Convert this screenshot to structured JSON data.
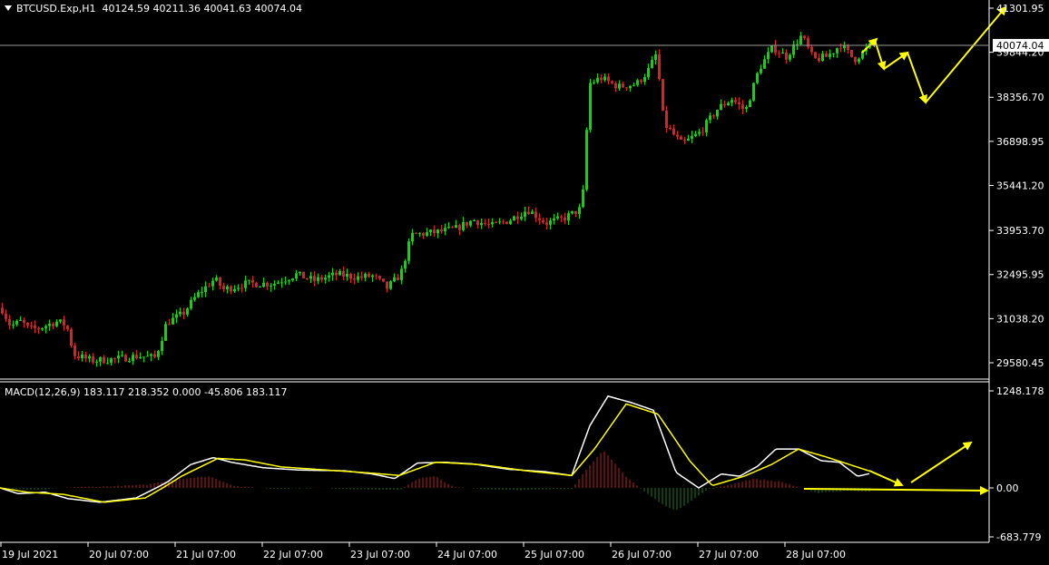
{
  "header": {
    "symbol": "BTCUSD.Exp,H1",
    "ohlc": "40124.59 40211.36 40041.63 40074.04"
  },
  "macd_header": "MACD(12,26,9) 183.117 218.352 0.000 -45.806 183.117",
  "colors": {
    "background": "#000000",
    "bull_candle": "#00e000",
    "bear_candle": "#e02020",
    "annotation": "#ffff00",
    "macd_line": "#ffffff",
    "signal_line": "#ffff00",
    "hist_pos": "#b22222",
    "hist_neg": "#1f7a1f",
    "grid": "#ffffff"
  },
  "price_axis": {
    "labels": [
      "41301.95",
      "39844.20",
      "38356.70",
      "36898.95",
      "35441.20",
      "33953.70",
      "32495.95",
      "31038.20",
      "29580.45"
    ],
    "current_price": "40074.04"
  },
  "macd_axis": {
    "labels": [
      "1248.178",
      "0.00",
      "-683.779"
    ]
  },
  "time_axis": {
    "labels": [
      "19 Jul 2021",
      "20 Jul 07:00",
      "21 Jul 07:00",
      "22 Jul 07:00",
      "23 Jul 07:00",
      "24 Jul 07:00",
      "25 Jul 07:00",
      "26 Jul 07:00",
      "27 Jul 07:00",
      "28 Jul 07:00"
    ]
  },
  "chart_data": {
    "type": "candlestick",
    "symbol": "BTCUSD.Exp",
    "timeframe": "H1",
    "y_range": [
      29200,
      41500
    ],
    "close_path": [
      {
        "t": 0,
        "v": 31400
      },
      {
        "t": 10,
        "v": 30800
      },
      {
        "t": 22,
        "v": 30950
      },
      {
        "t": 30,
        "v": 30700
      },
      {
        "t": 40,
        "v": 30700
      },
      {
        "t": 52,
        "v": 30850
      },
      {
        "t": 62,
        "v": 30950
      },
      {
        "t": 72,
        "v": 30800
      },
      {
        "t": 80,
        "v": 29850
      },
      {
        "t": 100,
        "v": 29650
      },
      {
        "t": 125,
        "v": 29700
      },
      {
        "t": 150,
        "v": 29800
      },
      {
        "t": 170,
        "v": 29750
      },
      {
        "t": 182,
        "v": 30900
      },
      {
        "t": 200,
        "v": 31200
      },
      {
        "t": 215,
        "v": 31800
      },
      {
        "t": 235,
        "v": 32350
      },
      {
        "t": 245,
        "v": 32000
      },
      {
        "t": 270,
        "v": 32200
      },
      {
        "t": 300,
        "v": 32200
      },
      {
        "t": 325,
        "v": 32500
      },
      {
        "t": 345,
        "v": 32300
      },
      {
        "t": 370,
        "v": 32500
      },
      {
        "t": 395,
        "v": 32400
      },
      {
        "t": 410,
        "v": 32450
      },
      {
        "t": 425,
        "v": 32050
      },
      {
        "t": 440,
        "v": 32500
      },
      {
        "t": 452,
        "v": 33800
      },
      {
        "t": 480,
        "v": 33900
      },
      {
        "t": 500,
        "v": 34000
      },
      {
        "t": 520,
        "v": 34300
      },
      {
        "t": 540,
        "v": 34100
      },
      {
        "t": 560,
        "v": 34300
      },
      {
        "t": 580,
        "v": 34650
      },
      {
        "t": 600,
        "v": 34200
      },
      {
        "t": 620,
        "v": 34350
      },
      {
        "t": 640,
        "v": 34700
      },
      {
        "t": 648,
        "v": 38800
      },
      {
        "t": 660,
        "v": 39000
      },
      {
        "t": 680,
        "v": 38700
      },
      {
        "t": 700,
        "v": 38800
      },
      {
        "t": 712,
        "v": 39200
      },
      {
        "t": 722,
        "v": 39800
      },
      {
        "t": 730,
        "v": 37500
      },
      {
        "t": 750,
        "v": 36800
      },
      {
        "t": 770,
        "v": 37200
      },
      {
        "t": 790,
        "v": 38000
      },
      {
        "t": 805,
        "v": 38300
      },
      {
        "t": 820,
        "v": 37900
      },
      {
        "t": 835,
        "v": 39300
      },
      {
        "t": 850,
        "v": 40000
      },
      {
        "t": 865,
        "v": 39700
      },
      {
        "t": 882,
        "v": 40400
      },
      {
        "t": 895,
        "v": 39600
      },
      {
        "t": 910,
        "v": 39700
      },
      {
        "t": 925,
        "v": 40100
      },
      {
        "t": 940,
        "v": 39600
      },
      {
        "t": 958,
        "v": 40074
      }
    ],
    "macd_line": [
      {
        "t": 0,
        "v": 0
      },
      {
        "t": 20,
        "v": -80
      },
      {
        "t": 50,
        "v": -60
      },
      {
        "t": 75,
        "v": -150
      },
      {
        "t": 110,
        "v": -200
      },
      {
        "t": 150,
        "v": -140
      },
      {
        "t": 185,
        "v": 80
      },
      {
        "t": 210,
        "v": 300
      },
      {
        "t": 235,
        "v": 390
      },
      {
        "t": 255,
        "v": 330
      },
      {
        "t": 290,
        "v": 260
      },
      {
        "t": 330,
        "v": 230
      },
      {
        "t": 380,
        "v": 220
      },
      {
        "t": 410,
        "v": 180
      },
      {
        "t": 435,
        "v": 120
      },
      {
        "t": 460,
        "v": 320
      },
      {
        "t": 490,
        "v": 330
      },
      {
        "t": 520,
        "v": 310
      },
      {
        "t": 560,
        "v": 240
      },
      {
        "t": 600,
        "v": 210
      },
      {
        "t": 630,
        "v": 160
      },
      {
        "t": 650,
        "v": 800
      },
      {
        "t": 670,
        "v": 1180
      },
      {
        "t": 695,
        "v": 1100
      },
      {
        "t": 720,
        "v": 1000
      },
      {
        "t": 745,
        "v": 200
      },
      {
        "t": 770,
        "v": 0
      },
      {
        "t": 795,
        "v": 180
      },
      {
        "t": 815,
        "v": 150
      },
      {
        "t": 835,
        "v": 280
      },
      {
        "t": 855,
        "v": 500
      },
      {
        "t": 880,
        "v": 500
      },
      {
        "t": 905,
        "v": 350
      },
      {
        "t": 925,
        "v": 330
      },
      {
        "t": 945,
        "v": 150
      },
      {
        "t": 958,
        "v": 183
      }
    ],
    "signal_line": [
      {
        "t": 0,
        "v": 0
      },
      {
        "t": 30,
        "v": -60
      },
      {
        "t": 70,
        "v": -90
      },
      {
        "t": 115,
        "v": -200
      },
      {
        "t": 160,
        "v": -140
      },
      {
        "t": 200,
        "v": 150
      },
      {
        "t": 240,
        "v": 380
      },
      {
        "t": 270,
        "v": 360
      },
      {
        "t": 310,
        "v": 270
      },
      {
        "t": 360,
        "v": 230
      },
      {
        "t": 410,
        "v": 190
      },
      {
        "t": 440,
        "v": 160
      },
      {
        "t": 480,
        "v": 330
      },
      {
        "t": 530,
        "v": 300
      },
      {
        "t": 580,
        "v": 220
      },
      {
        "t": 630,
        "v": 160
      },
      {
        "t": 655,
        "v": 500
      },
      {
        "t": 690,
        "v": 1080
      },
      {
        "t": 725,
        "v": 950
      },
      {
        "t": 760,
        "v": 350
      },
      {
        "t": 785,
        "v": 30
      },
      {
        "t": 820,
        "v": 150
      },
      {
        "t": 850,
        "v": 300
      },
      {
        "t": 880,
        "v": 500
      },
      {
        "t": 910,
        "v": 400
      },
      {
        "t": 958,
        "v": 218
      }
    ],
    "histogram_envelope": [
      {
        "t": 0,
        "v": 0
      },
      {
        "t": 40,
        "v": -30
      },
      {
        "t": 80,
        "v": 10
      },
      {
        "t": 120,
        "v": 20
      },
      {
        "t": 160,
        "v": 40
      },
      {
        "t": 200,
        "v": 120
      },
      {
        "t": 230,
        "v": 150
      },
      {
        "t": 260,
        "v": 20
      },
      {
        "t": 300,
        "v": -10
      },
      {
        "t": 350,
        "v": 0
      },
      {
        "t": 400,
        "v": -20
      },
      {
        "t": 440,
        "v": -30
      },
      {
        "t": 460,
        "v": 120
      },
      {
        "t": 480,
        "v": 150
      },
      {
        "t": 500,
        "v": 10
      },
      {
        "t": 540,
        "v": -20
      },
      {
        "t": 580,
        "v": -30
      },
      {
        "t": 630,
        "v": -10
      },
      {
        "t": 650,
        "v": 300
      },
      {
        "t": 665,
        "v": 480
      },
      {
        "t": 690,
        "v": 150
      },
      {
        "t": 710,
        "v": -50
      },
      {
        "t": 730,
        "v": -230
      },
      {
        "t": 745,
        "v": -320
      },
      {
        "t": 765,
        "v": -150
      },
      {
        "t": 780,
        "v": -20
      },
      {
        "t": 800,
        "v": 30
      },
      {
        "t": 830,
        "v": 120
      },
      {
        "t": 860,
        "v": 80
      },
      {
        "t": 880,
        "v": 10
      },
      {
        "t": 900,
        "v": -70
      },
      {
        "t": 930,
        "v": -40
      },
      {
        "t": 958,
        "v": -46
      }
    ]
  }
}
